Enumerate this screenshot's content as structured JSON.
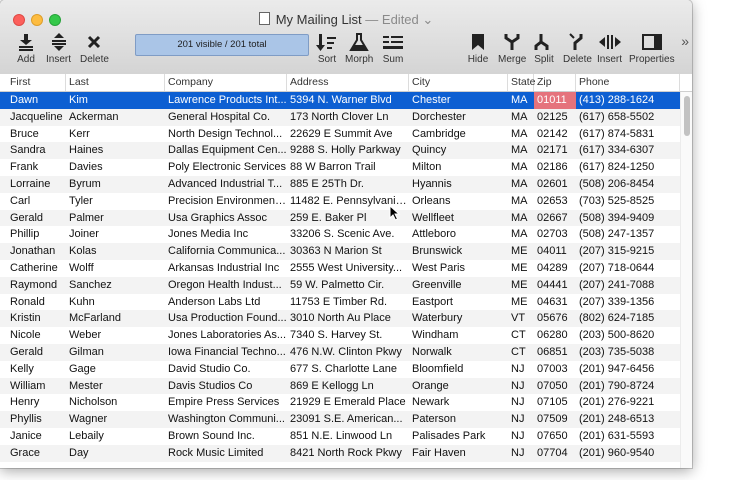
{
  "window": {
    "title": "My Mailing List",
    "edited_suffix": "— Edited ⌄"
  },
  "toolbar": {
    "add_label": "Add",
    "insert_label": "Insert",
    "delete_label": "Delete",
    "status": "201 visible / 201 total",
    "sort_label": "Sort",
    "morph_label": "Morph",
    "sum_label": "Sum",
    "hide_label": "Hide",
    "merge_label": "Merge",
    "split_label": "Split",
    "col_delete_label": "Delete",
    "col_insert_label": "Insert",
    "properties_label": "Properties",
    "overflow": "»"
  },
  "table": {
    "columns": [
      "First",
      "Last",
      "Company",
      "Address",
      "City",
      "State",
      "Zip",
      "Phone"
    ],
    "selected_row": 0,
    "highlighted_cell_column": "Zip",
    "rows": [
      [
        "Dawn",
        "Kim",
        "Lawrence Products Int...",
        "5394 N. Warner Blvd",
        "Chester",
        "MA",
        "01011",
        "(413) 288-1624"
      ],
      [
        "Jacqueline",
        "Ackerman",
        "General Hospital Co.",
        "173 North Clover Ln",
        "Dorchester",
        "MA",
        "02125",
        "(617) 658-5502"
      ],
      [
        "Bruce",
        "Kerr",
        "North Design Technol...",
        "22629 E Summit Ave",
        "Cambridge",
        "MA",
        "02142",
        "(617) 874-5831"
      ],
      [
        "Sandra",
        "Haines",
        "Dallas Equipment Cen...",
        "9288 S. Holly Parkway",
        "Quincy",
        "MA",
        "02171",
        "(617) 334-6307"
      ],
      [
        "Frank",
        "Davies",
        "Poly Electronic Services",
        "88 W Barron Trail",
        "Milton",
        "MA",
        "02186",
        "(617) 824-1250"
      ],
      [
        "Lorraine",
        "Byrum",
        "Advanced Industrial T...",
        "885 E 25Th Dr.",
        "Hyannis",
        "MA",
        "02601",
        "(508) 206-8454"
      ],
      [
        "Carl",
        "Tyler",
        "Precision Environment...",
        "11482 E. Pennsylvania...",
        "Orleans",
        "MA",
        "02653",
        "(703) 525-8525"
      ],
      [
        "Gerald",
        "Palmer",
        "Usa Graphics Assoc",
        "259 E. Baker Pl",
        "Wellfleet",
        "MA",
        "02667",
        "(508) 394-9409"
      ],
      [
        "Phillip",
        "Joiner",
        "Jones Media Inc",
        "33206 S. Scenic Ave.",
        "Attleboro",
        "MA",
        "02703",
        "(508) 247-1357"
      ],
      [
        "Jonathan",
        "Kolas",
        "California Communica...",
        "30363 N Marion St",
        "Brunswick",
        "ME",
        "04011",
        "(207) 315-9215"
      ],
      [
        "Catherine",
        "Wolff",
        "Arkansas Industrial Inc",
        "2555 West University...",
        "West Paris",
        "ME",
        "04289",
        "(207) 718-0644"
      ],
      [
        "Raymond",
        "Sanchez",
        "Oregon Health Indust...",
        "59 W. Palmetto Cir.",
        "Greenville",
        "ME",
        "04441",
        "(207) 241-7088"
      ],
      [
        "Ronald",
        "Kuhn",
        "Anderson Labs Ltd",
        "11753 E Timber Rd.",
        "Eastport",
        "ME",
        "04631",
        "(207) 339-1356"
      ],
      [
        "Kristin",
        "McFarland",
        "Usa Production Found...",
        "3010 North Au Place",
        "Waterbury",
        "VT",
        "05676",
        "(802) 624-7185"
      ],
      [
        "Nicole",
        "Weber",
        "Jones Laboratories As...",
        "7340 S. Harvey St.",
        "Windham",
        "CT",
        "06280",
        "(203) 500-8620"
      ],
      [
        "Gerald",
        "Gilman",
        "Iowa Financial Techno...",
        "476 N.W. Clinton Pkwy",
        "Norwalk",
        "CT",
        "06851",
        "(203) 735-5038"
      ],
      [
        "Kelly",
        "Gage",
        "David Studio Co.",
        "677 S. Charlotte Lane",
        "Bloomfield",
        "NJ",
        "07003",
        "(201) 947-6456"
      ],
      [
        "William",
        "Mester",
        "Davis Studios Co",
        "869 E Kellogg Ln",
        "Orange",
        "NJ",
        "07050",
        "(201) 790-8724"
      ],
      [
        "Henry",
        "Nicholson",
        "Empire Press Services",
        "21929 E Emerald Place",
        "Newark",
        "NJ",
        "07105",
        "(201) 276-9221"
      ],
      [
        "Phyllis",
        "Wagner",
        "Washington Communi...",
        "23091 S.E. American...",
        "Paterson",
        "NJ",
        "07509",
        "(201) 248-6513"
      ],
      [
        "Janice",
        "Lebaily",
        "Brown Sound Inc.",
        "851 N.E. Linwood Ln",
        "Palisades Park",
        "NJ",
        "07650",
        "(201) 631-5593"
      ],
      [
        "Grace",
        "Day",
        "Rock Music Limited",
        "8421 North Rock Pkwy",
        "Fair Haven",
        "NJ",
        "07704",
        "(201) 960-9540"
      ]
    ]
  },
  "colors": {
    "selection": "#0d5fd2",
    "highlight_cell": "#e5737c",
    "status_box": "#aac5e7"
  }
}
